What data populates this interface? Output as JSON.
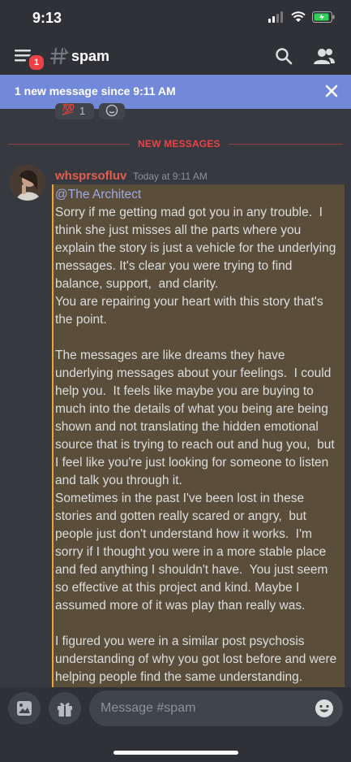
{
  "status": {
    "time": "9:13"
  },
  "header": {
    "badge": "1",
    "channel": "spam"
  },
  "banner": {
    "text": "1 new message since 9:11 AM"
  },
  "reactions": [
    {
      "emoji": "💯",
      "count": "1"
    }
  ],
  "divider": {
    "label": "NEW MESSAGES"
  },
  "message": {
    "author": "whsprsofluv",
    "timestamp": "Today at 9:11 AM",
    "mention": "@The Architect",
    "body": "Sorry if me getting mad got you in any trouble.  I think she just misses all the parts where you explain the story is just a vehicle for the underlying messages. It's clear you were trying to find balance, support,  and clarity.\nYou are repairing your heart with this story that's the point.\n\nThe messages are like dreams they have underlying messages about your feelings.  I could help you.  It feels like maybe you are buying to much into the details of what you being are being shown and not translating the hidden emotional source that is trying to reach out and hug you,  but I feel like you're just looking for someone to listen and talk you through it.\nSometimes in the past I've been lost in these stories and gotten really scared or angry,  but people just don't understand how it works.  I'm sorry if I thought you were in a more stable place and fed anything I shouldn't have.  You just seem so effective at this project and kind. Maybe I assumed more of it was play than really was.\n\nI figured you were in a similar post psychosis understanding of why you got lost before and were helping people find the same understanding."
  },
  "composer": {
    "placeholder": "Message #spam"
  },
  "colors": {
    "background": "#36393f",
    "banner": "#7289da",
    "mention_highlight": "#5a4d39",
    "new_messages": "#ed4245",
    "username": "#e35d4f"
  }
}
